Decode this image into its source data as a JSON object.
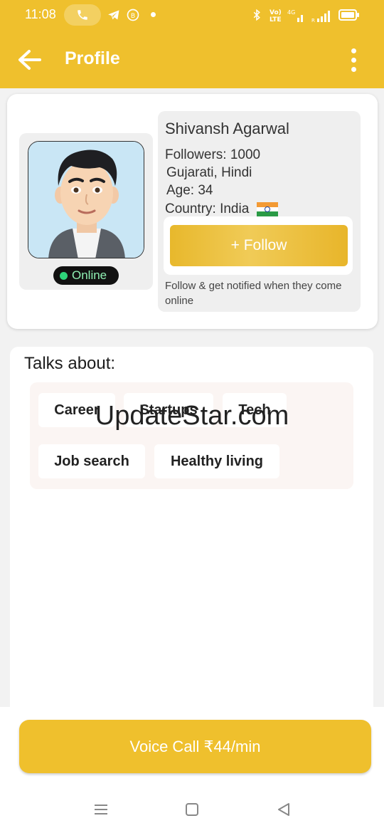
{
  "status_bar": {
    "time": "11:08",
    "icons": [
      "phone-icon",
      "telegram-icon",
      "b-circle-icon",
      "bluetooth-icon",
      "volte-icon",
      "4g-signal-icon",
      "battery-icon"
    ]
  },
  "appbar": {
    "title": "Profile",
    "back_icon": "arrow-left-icon",
    "menu_icon": "more-vertical-icon"
  },
  "profile": {
    "name": "Shivansh Agarwal",
    "followers": "Followers: 1000",
    "languages": "Gujarati, Hindi",
    "age": "Age: 34",
    "country": "Country: India",
    "status": "Online",
    "follow_label": "+ Follow",
    "follow_note": "Follow & get notified when they come online",
    "colors": {
      "online": "#2ed37a",
      "accent": "#efc02d"
    }
  },
  "talks": {
    "title": "Talks about:",
    "tags": [
      "Career",
      "Startups",
      "Tech",
      "Job search",
      "Healthy living"
    ]
  },
  "watermark": "UpdateStar.com",
  "bottom": {
    "voice_call_label": "Voice Call ₹44/min"
  },
  "navbar": {
    "icons": [
      "menu-icon",
      "home-square-icon",
      "back-triangle-icon"
    ]
  }
}
